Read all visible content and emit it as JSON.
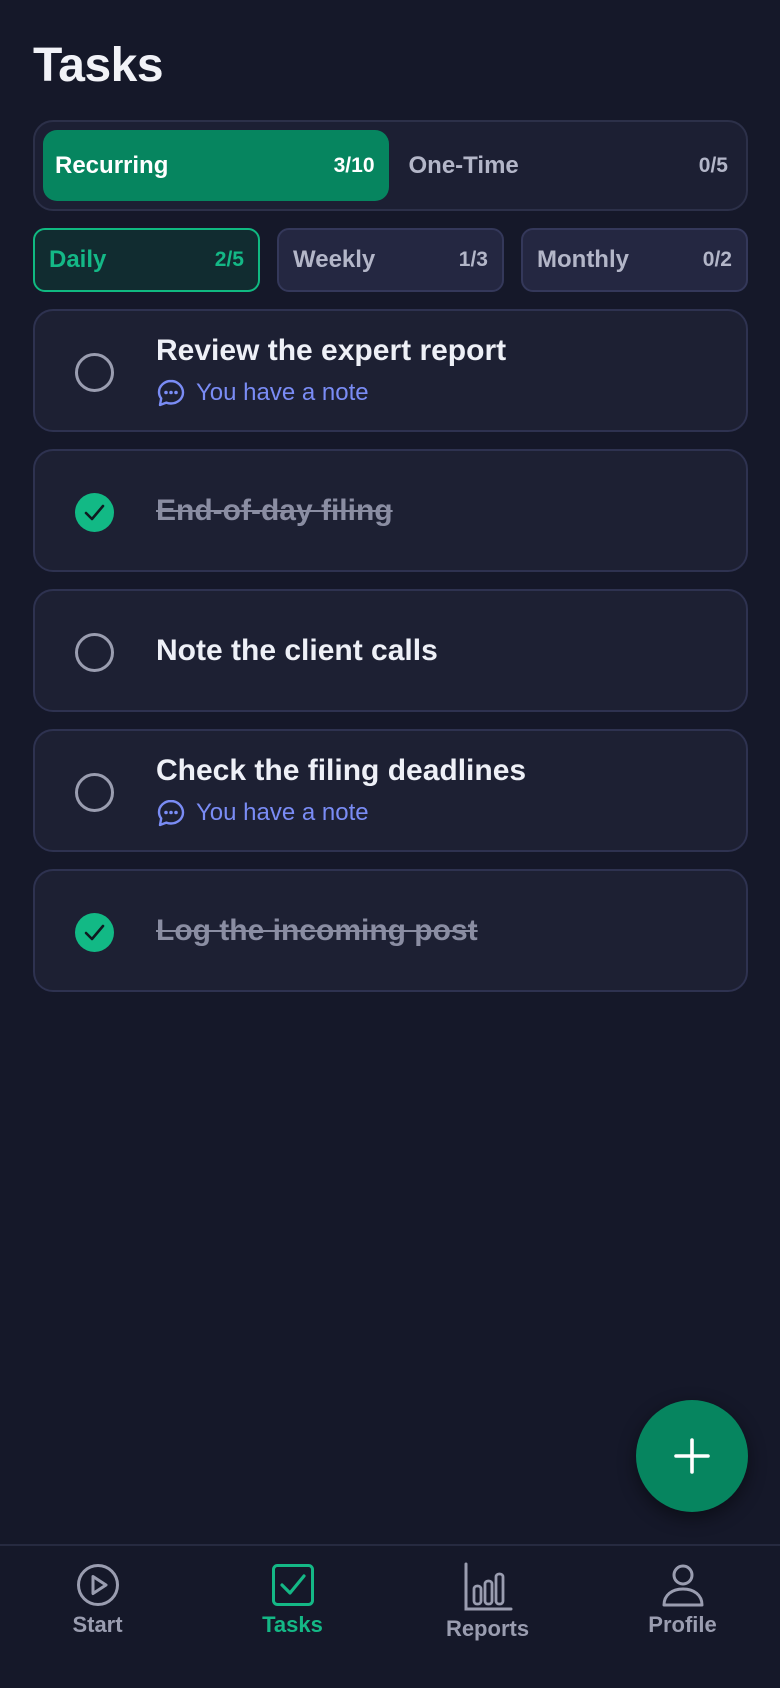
{
  "page": {
    "title": "Tasks"
  },
  "segment": {
    "items": [
      {
        "label": "Recurring",
        "count": "3/10",
        "active": true
      },
      {
        "label": "One-Time",
        "count": "0/5",
        "active": false
      }
    ]
  },
  "periods": {
    "items": [
      {
        "label": "Daily",
        "count": "2/5",
        "active": true
      },
      {
        "label": "Weekly",
        "count": "1/3",
        "active": false
      },
      {
        "label": "Monthly",
        "count": "0/2",
        "active": false
      }
    ]
  },
  "tasks": [
    {
      "title": "Review the expert report",
      "done": false,
      "note": "You have a note"
    },
    {
      "title": "End-of-day filing",
      "done": true,
      "note": null
    },
    {
      "title": "Note the client calls",
      "done": false,
      "note": null
    },
    {
      "title": "Check the filing deadlines",
      "done": false,
      "note": "You have a note"
    },
    {
      "title": "Log the incoming post",
      "done": true,
      "note": null
    }
  ],
  "fab": {
    "icon": "plus-icon"
  },
  "nav": {
    "items": [
      {
        "label": "Start",
        "icon": "play-circle-icon",
        "active": false
      },
      {
        "label": "Tasks",
        "icon": "checkbox-icon",
        "active": true
      },
      {
        "label": "Reports",
        "icon": "bar-chart-icon",
        "active": false
      },
      {
        "label": "Profile",
        "icon": "user-icon",
        "active": false
      }
    ]
  },
  "colors": {
    "background": "#151829",
    "accent": "#06855f",
    "accent_text": "#14b886",
    "note": "#7a8cf5",
    "card": "#1d2033"
  }
}
